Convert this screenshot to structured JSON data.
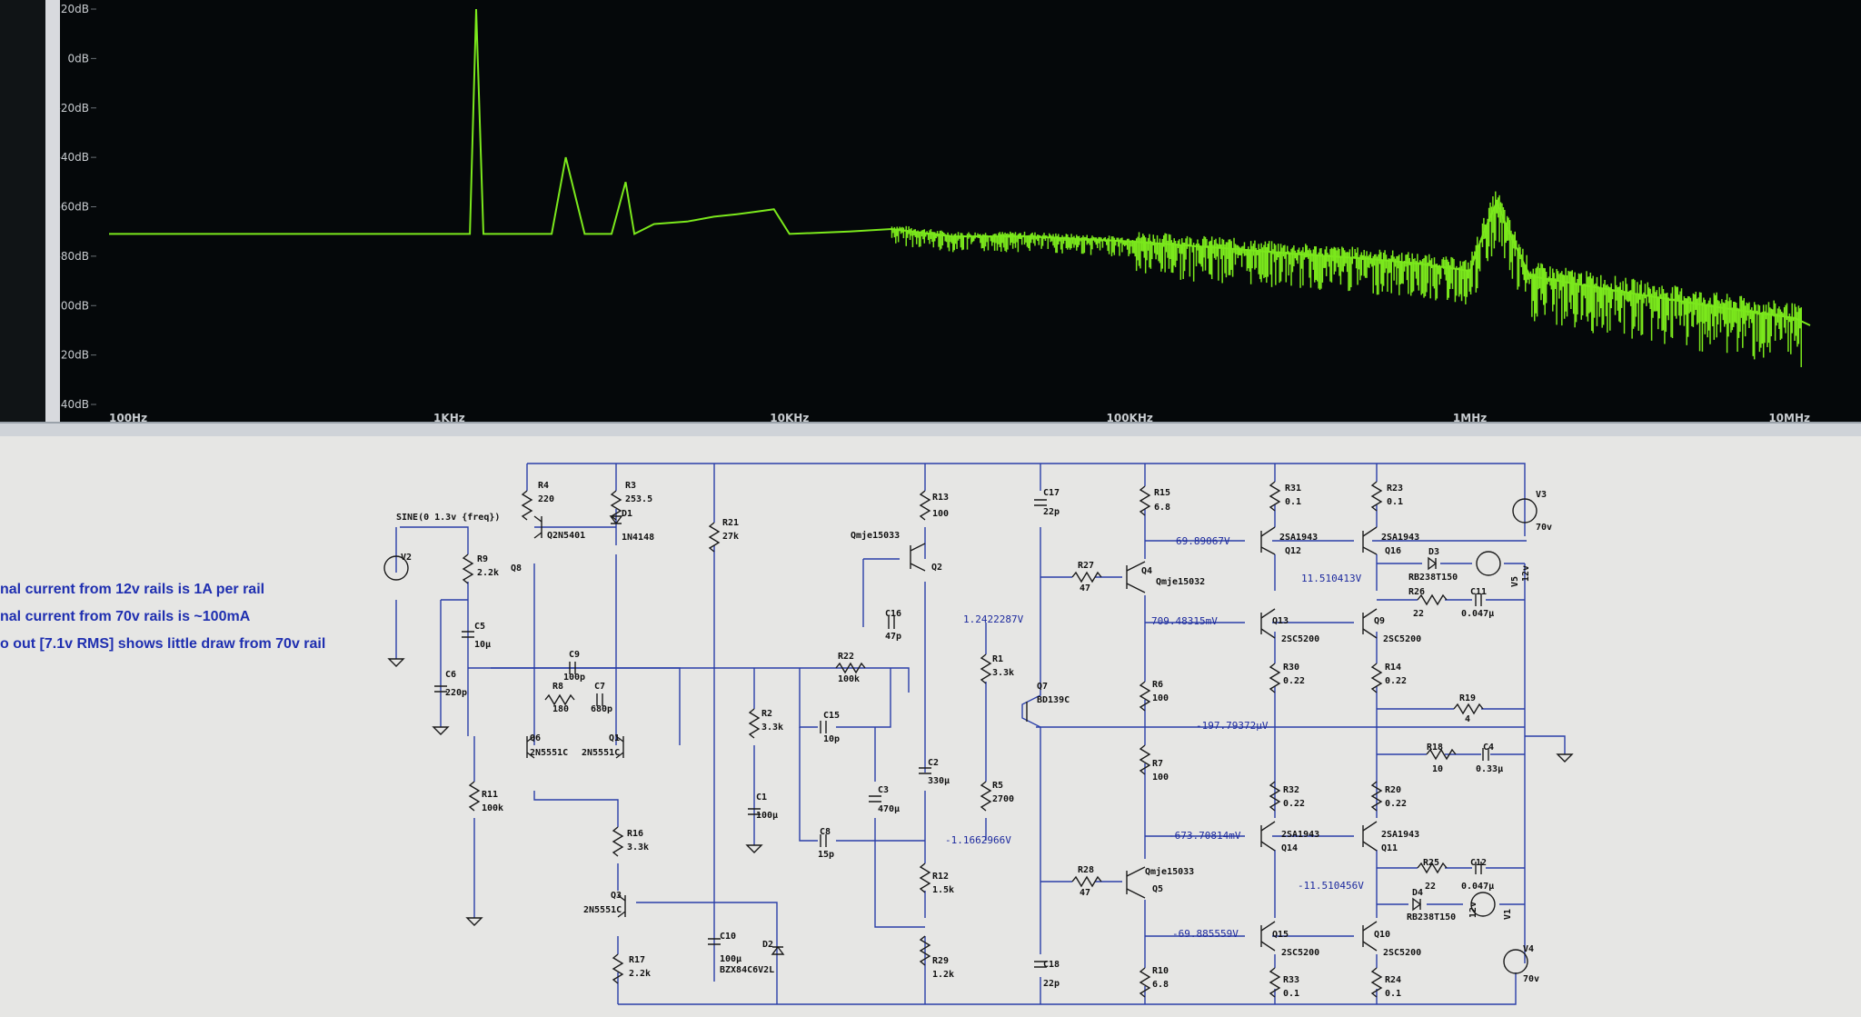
{
  "chart_data": {
    "type": "line",
    "title": "",
    "xlabel": "",
    "ylabel": "",
    "xscale": "log",
    "xlim": [
      100,
      10000000
    ],
    "ylim": [
      -140,
      20
    ],
    "grid": false,
    "y_ticks": [
      "20dB",
      "0dB",
      "-20dB",
      "-40dB",
      "-60dB",
      "-80dB",
      "-100dB",
      "-120dB",
      "-140dB"
    ],
    "y_tick_values": [
      20,
      0,
      -20,
      -40,
      -60,
      -80,
      -100,
      -120,
      -140
    ],
    "x_ticks": [
      "100Hz",
      "1KHz",
      "10KHz",
      "100KHz",
      "1MHz",
      "10MHz"
    ],
    "x_tick_values": [
      100,
      1000,
      10000,
      100000,
      1000000,
      10000000
    ],
    "trace_color": "#7be81c",
    "series": [
      {
        "x": [
          100,
          1000,
          1150,
          1200,
          1260,
          1300,
          1500,
          2000,
          2200,
          2500,
          3000,
          3300,
          3500,
          4000,
          5000,
          6000,
          7000,
          8000,
          9000,
          10000,
          15000,
          20000,
          30000,
          50000,
          70000,
          100000,
          200000,
          300000,
          500000,
          700000,
          900000,
          1000000,
          1100000,
          1200000,
          1300000,
          1500000,
          2000000,
          3000000,
          5000000,
          7000000,
          9000000,
          10000000
        ],
        "y": [
          -71,
          -71,
          -71,
          20,
          -71,
          -71,
          -71,
          -71,
          -40,
          -71,
          -71,
          -50,
          -71,
          -67,
          -66,
          -64,
          -63,
          -62,
          -61,
          -71,
          -70,
          -69,
          -72,
          -72,
          -73,
          -74,
          -77,
          -79,
          -81,
          -83,
          -85,
          -86,
          -70,
          -58,
          -70,
          -88,
          -91,
          -95,
          -100,
          -103,
          -105,
          -108
        ]
      }
    ]
  },
  "schematic": {
    "annotations": [
      "nal current from 12v rails is 1A per rail",
      "nal current from 70v rails is ~100mA",
      "o out [7.1v RMS] shows little draw from 70v rail"
    ],
    "source_directive": "SINE(0 1.3v {freq})",
    "components": [
      {
        "ref": "V2"
      },
      {
        "ref": "R9",
        "value": "2.2k"
      },
      {
        "ref": "C5",
        "value": "10µ"
      },
      {
        "ref": "C6",
        "value": "220p"
      },
      {
        "ref": "R11",
        "value": "100k"
      },
      {
        "ref": "R4",
        "value": "220"
      },
      {
        "ref": "R3",
        "value": "253.5"
      },
      {
        "ref": "D1",
        "value": "1N4148"
      },
      {
        "ref": "Q8",
        "value": "Q2N5401"
      },
      {
        "ref": "C9",
        "value": "100p"
      },
      {
        "ref": "R8",
        "value": "180"
      },
      {
        "ref": "C7",
        "value": "680p"
      },
      {
        "ref": "Q6",
        "value": "2N5551C"
      },
      {
        "ref": "Q1",
        "value": "2N5551C"
      },
      {
        "ref": "R16",
        "value": "3.3k"
      },
      {
        "ref": "Q3",
        "value": "2N5551C"
      },
      {
        "ref": "R17",
        "value": "2.2k"
      },
      {
        "ref": "R21",
        "value": "27k"
      },
      {
        "ref": "C10",
        "value": "100µ"
      },
      {
        "ref": "D2",
        "value": "BZX84C6V2L"
      },
      {
        "ref": "R2",
        "value": "3.3k"
      },
      {
        "ref": "C1",
        "value": "100µ"
      },
      {
        "ref": "R22",
        "value": "100k"
      },
      {
        "ref": "C15",
        "value": "10p"
      },
      {
        "ref": "C8",
        "value": "15p"
      },
      {
        "ref": "C3",
        "value": "470µ"
      },
      {
        "ref": "C16",
        "value": "47p"
      },
      {
        "ref": "R13",
        "value": "100"
      },
      {
        "ref": "Q2",
        "value": "Qmje15033"
      },
      {
        "ref": "C2",
        "value": "330µ"
      },
      {
        "ref": "R12",
        "value": "1.5k"
      },
      {
        "ref": "R29",
        "value": "1.2k"
      },
      {
        "ref": "C17",
        "value": "22p"
      },
      {
        "ref": "R1",
        "value": "3.3k"
      },
      {
        "ref": "R5",
        "value": "2700"
      },
      {
        "ref": "Q7",
        "value": "BD139C"
      },
      {
        "ref": "C18",
        "value": "22p"
      },
      {
        "ref": "R27",
        "value": "47"
      },
      {
        "ref": "R28",
        "value": "47"
      },
      {
        "ref": "R15",
        "value": "6.8"
      },
      {
        "ref": "Q4",
        "value": "Qmje15032"
      },
      {
        "ref": "R6",
        "value": "100"
      },
      {
        "ref": "R7",
        "value": "100"
      },
      {
        "ref": "Q5",
        "value": "Qmje15033"
      },
      {
        "ref": "R10",
        "value": "6.8"
      },
      {
        "ref": "R31",
        "value": "0.1"
      },
      {
        "ref": "Q12",
        "value": "2SA1943"
      },
      {
        "ref": "Q13",
        "value": "2SC5200"
      },
      {
        "ref": "R30",
        "value": "0.22"
      },
      {
        "ref": "R32",
        "value": "0.22"
      },
      {
        "ref": "Q14",
        "value": "2SA1943"
      },
      {
        "ref": "Q15",
        "value": "2SC5200"
      },
      {
        "ref": "R33",
        "value": "0.1"
      },
      {
        "ref": "R23",
        "value": "0.1"
      },
      {
        "ref": "Q16",
        "value": "2SA1943"
      },
      {
        "ref": "Q9",
        "value": "2SC5200"
      },
      {
        "ref": "R14",
        "value": "0.22"
      },
      {
        "ref": "R20",
        "value": "0.22"
      },
      {
        "ref": "Q11",
        "value": "2SA1943"
      },
      {
        "ref": "Q10",
        "value": "2SC5200"
      },
      {
        "ref": "R24",
        "value": "0.1"
      },
      {
        "ref": "D3",
        "value": "RB238T150"
      },
      {
        "ref": "D4",
        "value": "RB238T150"
      },
      {
        "ref": "R26",
        "value": "22"
      },
      {
        "ref": "C11",
        "value": "0.047µ"
      },
      {
        "ref": "R25",
        "value": "22"
      },
      {
        "ref": "C12",
        "value": "0.047µ"
      },
      {
        "ref": "V5",
        "value": "12v"
      },
      {
        "ref": "V1",
        "value": "12v"
      },
      {
        "ref": "V3",
        "value": "70v"
      },
      {
        "ref": "V4",
        "value": "70v"
      },
      {
        "ref": "R19",
        "value": "4"
      },
      {
        "ref": "R18",
        "value": "10"
      },
      {
        "ref": "C4",
        "value": "0.33µ"
      }
    ],
    "node_voltages": [
      "69.89067V",
      "11.510413V",
      "709.48315mV",
      "1.2422287V",
      "-197.79372µV",
      "-1.1662966V",
      "-673.70814mV",
      "-11.510456V",
      "-69.885559V"
    ]
  }
}
